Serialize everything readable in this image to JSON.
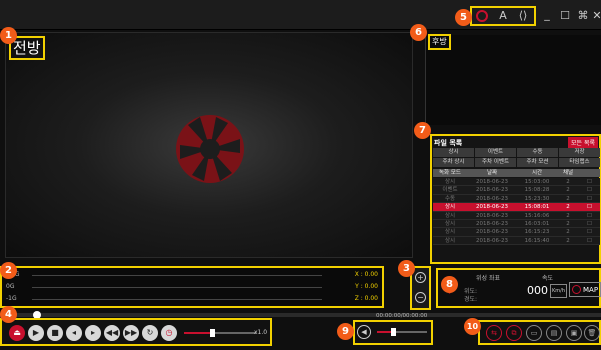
{
  "colors": {
    "accent": "#f2d100",
    "brand_red": "#c8102e",
    "badge": "#f25c19"
  },
  "window_controls": {
    "font_btn": "A",
    "code_btn": "⟨⟩",
    "minimize": "_",
    "maximize": "☐",
    "settings": "⌘",
    "close": "✕"
  },
  "video": {
    "front_label": "전방",
    "rear_label": "후방"
  },
  "file_list": {
    "title": "파일 목록",
    "all_button": "모든 목록",
    "filter_row1": [
      "상시",
      "이벤트",
      "수동",
      "저장"
    ],
    "filter_row2": [
      "주차 상시",
      "주차 이벤트",
      "주차 모션",
      "타임랩스"
    ],
    "columns": [
      "녹화 모드",
      "날짜",
      "시간",
      "채널",
      ""
    ],
    "rows": [
      {
        "mode": "상시",
        "date": "2018-06-23",
        "time": "15:03:00",
        "ch": "2",
        "chk": "☐"
      },
      {
        "mode": "이벤트",
        "date": "2018-06-23",
        "time": "15:08:28",
        "ch": "2",
        "chk": "☐"
      },
      {
        "mode": "수동",
        "date": "2018-06-23",
        "time": "15:23:30",
        "ch": "2",
        "chk": "☐"
      },
      {
        "mode": "상시",
        "date": "2018-06-23",
        "time": "15:08:01",
        "ch": "2",
        "chk": "☐"
      },
      {
        "mode": "상시",
        "date": "2018-06-23",
        "time": "15:16:06",
        "ch": "2",
        "chk": "☐"
      },
      {
        "mode": "상시",
        "date": "2018-06-23",
        "time": "16:03:01",
        "ch": "2",
        "chk": "☐"
      },
      {
        "mode": "상시",
        "date": "2018-06-23",
        "time": "16:15:23",
        "ch": "2",
        "chk": "☐"
      },
      {
        "mode": "상시",
        "date": "2018-06-23",
        "time": "16:15:40",
        "ch": "2",
        "chk": "☐"
      }
    ]
  },
  "gsensor": {
    "rows": [
      {
        "left": "+1G",
        "right": "X : 0.00"
      },
      {
        "left": "0G",
        "right": "Y : 0.00"
      },
      {
        "left": "-1G",
        "right": "Z : 0.00"
      }
    ]
  },
  "gps": {
    "coord_label": "위성 좌표",
    "speed_label": "속도",
    "lat": "위도:",
    "lon": "경도:",
    "speed": "000",
    "unit": "Km/h",
    "map": "MAP"
  },
  "playback": {
    "time": "00:00:00/00:00:00",
    "speed": "x1.0"
  },
  "badges": [
    "1",
    "2",
    "3",
    "4",
    "5",
    "6",
    "7",
    "8",
    "9",
    "10"
  ]
}
